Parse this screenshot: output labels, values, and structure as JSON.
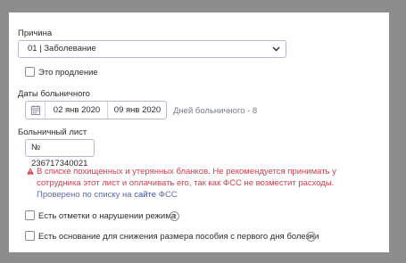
{
  "reason": {
    "label": "Причина",
    "selected": "01 | Заболевание"
  },
  "extension": {
    "label": "Это продление",
    "checked": false
  },
  "sick_dates": {
    "label": "Даты больничного",
    "start": "02 янв 2020",
    "end": "09 янв 2020",
    "days_hint": "Дней больничного - 8"
  },
  "sick_list": {
    "label": "Больничный лист",
    "number": "№ 236717340021"
  },
  "warning": {
    "text": "В списке похищенных и утерянных бланков. Не рекомендуется принимать у сотрудника этот лист и оплачивать его, так как ФСС не возместит расходы.",
    "verified_prefix": "Проверено по списку на ",
    "verified_link": "сайте",
    "verified_suffix": " ФСС"
  },
  "options": [
    {
      "label": "Есть отметки о нарушении режима",
      "checked": false
    },
    {
      "label": "Есть основание для снижения размера пособия с первого дня болезни",
      "checked": false
    }
  ],
  "colors": {
    "accent_border": "#b9b6d6",
    "warning": "#d23d4d",
    "link": "#3b4fb5",
    "frame": "#8d8d8d"
  },
  "icons": [
    "chevron-down-icon",
    "calendar-icon",
    "warning-icon",
    "help-icon"
  ]
}
